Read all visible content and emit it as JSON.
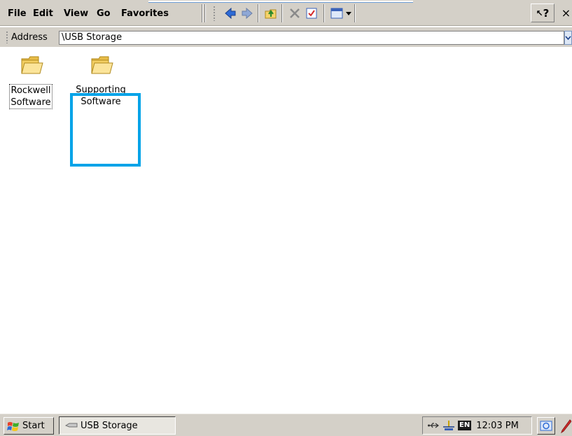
{
  "menubar": {
    "items": [
      {
        "label": "File"
      },
      {
        "label": "Edit"
      },
      {
        "label": "View"
      },
      {
        "label": "Go"
      },
      {
        "label": "Favorites"
      }
    ]
  },
  "toolbar": {
    "buttons": [
      {
        "icon": "back-arrow-icon"
      },
      {
        "icon": "forward-arrow-icon"
      },
      {
        "icon": "up-folder-icon"
      },
      {
        "icon": "delete-icon"
      },
      {
        "icon": "properties-icon"
      },
      {
        "icon": "views-icon"
      }
    ],
    "help_label": "?",
    "close_label": "×"
  },
  "address": {
    "label": "Address",
    "value": "\\USB Storage"
  },
  "files": [
    {
      "label_line1": "Rockwell",
      "label_line2": "Software",
      "icon": "folder-icon"
    },
    {
      "label_line1": "Supporting",
      "label_line2": "Software",
      "icon": "folder-icon"
    }
  ],
  "colors": {
    "highlight": "#00a3e8",
    "chrome": "#d4d0c8",
    "folder": "#f5d36a"
  },
  "taskbar": {
    "start_label": "Start",
    "task_label": "USB Storage",
    "language": "EN",
    "clock": "12:03 PM"
  }
}
